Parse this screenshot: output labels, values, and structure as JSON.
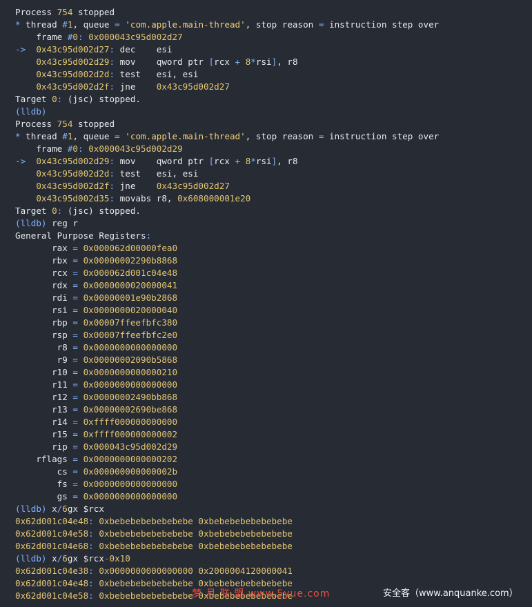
{
  "terminal": {
    "lines": [
      [
        [
          "w",
          "Process "
        ],
        [
          "y",
          "754"
        ],
        [
          "w",
          " stopped"
        ]
      ],
      [
        [
          "b",
          "* "
        ],
        [
          "w",
          "thread "
        ],
        [
          "b",
          "#"
        ],
        [
          "y",
          "1"
        ],
        [
          "w",
          ", queue "
        ],
        [
          "b",
          "="
        ],
        [
          "w",
          " "
        ],
        [
          "s",
          "'com.apple.main-thread'"
        ],
        [
          "w",
          ", stop reason "
        ],
        [
          "b",
          "="
        ],
        [
          "w",
          " instruction step over"
        ]
      ],
      [
        [
          "w",
          "    frame "
        ],
        [
          "b",
          "#"
        ],
        [
          "y",
          "0"
        ],
        [
          "b",
          ": "
        ],
        [
          "y",
          "0x000043c95d002d27"
        ]
      ],
      [
        [
          "b",
          "->  "
        ],
        [
          "y",
          "0x43c95d002d27"
        ],
        [
          "b",
          ": "
        ],
        [
          "w",
          "dec    esi"
        ]
      ],
      [
        [
          "w",
          "    "
        ],
        [
          "y",
          "0x43c95d002d29"
        ],
        [
          "b",
          ": "
        ],
        [
          "w",
          "mov    qword ptr "
        ],
        [
          "b",
          "["
        ],
        [
          "w",
          "rcx "
        ],
        [
          "b",
          "+"
        ],
        [
          "w",
          " "
        ],
        [
          "y",
          "8"
        ],
        [
          "b",
          "*"
        ],
        [
          "w",
          "rsi"
        ],
        [
          "b",
          "]"
        ],
        [
          "w",
          ", r8"
        ]
      ],
      [
        [
          "w",
          "    "
        ],
        [
          "y",
          "0x43c95d002d2d"
        ],
        [
          "b",
          ": "
        ],
        [
          "w",
          "test   esi, esi"
        ]
      ],
      [
        [
          "w",
          "    "
        ],
        [
          "y",
          "0x43c95d002d2f"
        ],
        [
          "b",
          ": "
        ],
        [
          "w",
          "jne    "
        ],
        [
          "y",
          "0x43c95d002d27"
        ]
      ],
      [
        [
          "w",
          "Target "
        ],
        [
          "y",
          "0"
        ],
        [
          "b",
          ": "
        ],
        [
          "w",
          "(jsc) stopped."
        ]
      ],
      [
        [
          "b",
          "(lldb)"
        ]
      ],
      [
        [
          "w",
          "Process "
        ],
        [
          "y",
          "754"
        ],
        [
          "w",
          " stopped"
        ]
      ],
      [
        [
          "b",
          "* "
        ],
        [
          "w",
          "thread "
        ],
        [
          "b",
          "#"
        ],
        [
          "y",
          "1"
        ],
        [
          "w",
          ", queue "
        ],
        [
          "b",
          "="
        ],
        [
          "w",
          " "
        ],
        [
          "s",
          "'com.apple.main-thread'"
        ],
        [
          "w",
          ", stop reason "
        ],
        [
          "b",
          "="
        ],
        [
          "w",
          " instruction step over"
        ]
      ],
      [
        [
          "w",
          "    frame "
        ],
        [
          "b",
          "#"
        ],
        [
          "y",
          "0"
        ],
        [
          "b",
          ": "
        ],
        [
          "y",
          "0x000043c95d002d29"
        ]
      ],
      [
        [
          "b",
          "->  "
        ],
        [
          "y",
          "0x43c95d002d29"
        ],
        [
          "b",
          ": "
        ],
        [
          "w",
          "mov    qword ptr "
        ],
        [
          "b",
          "["
        ],
        [
          "w",
          "rcx "
        ],
        [
          "b",
          "+"
        ],
        [
          "w",
          " "
        ],
        [
          "y",
          "8"
        ],
        [
          "b",
          "*"
        ],
        [
          "w",
          "rsi"
        ],
        [
          "b",
          "]"
        ],
        [
          "w",
          ", r8"
        ]
      ],
      [
        [
          "w",
          "    "
        ],
        [
          "y",
          "0x43c95d002d2d"
        ],
        [
          "b",
          ": "
        ],
        [
          "w",
          "test   esi, esi"
        ]
      ],
      [
        [
          "w",
          "    "
        ],
        [
          "y",
          "0x43c95d002d2f"
        ],
        [
          "b",
          ": "
        ],
        [
          "w",
          "jne    "
        ],
        [
          "y",
          "0x43c95d002d27"
        ]
      ],
      [
        [
          "w",
          "    "
        ],
        [
          "y",
          "0x43c95d002d35"
        ],
        [
          "b",
          ": "
        ],
        [
          "w",
          "movabs r8, "
        ],
        [
          "y",
          "0x608000001e20"
        ]
      ],
      [
        [
          "w",
          "Target "
        ],
        [
          "y",
          "0"
        ],
        [
          "b",
          ": "
        ],
        [
          "w",
          "(jsc) stopped."
        ]
      ],
      [
        [
          "b",
          "(lldb) "
        ],
        [
          "w",
          "reg r"
        ]
      ],
      [
        [
          "w",
          "General Purpose Registers"
        ],
        [
          "b",
          ":"
        ]
      ],
      [
        [
          "w",
          "       rax "
        ],
        [
          "b",
          "="
        ],
        [
          "w",
          " "
        ],
        [
          "y",
          "0x000062d00000fea0"
        ]
      ],
      [
        [
          "w",
          "       rbx "
        ],
        [
          "b",
          "="
        ],
        [
          "w",
          " "
        ],
        [
          "y",
          "0x00000002290b8868"
        ]
      ],
      [
        [
          "w",
          "       rcx "
        ],
        [
          "b",
          "="
        ],
        [
          "w",
          " "
        ],
        [
          "y",
          "0x000062d001c04e48"
        ]
      ],
      [
        [
          "w",
          "       rdx "
        ],
        [
          "b",
          "="
        ],
        [
          "w",
          " "
        ],
        [
          "y",
          "0x0000000020000041"
        ]
      ],
      [
        [
          "w",
          "       rdi "
        ],
        [
          "b",
          "="
        ],
        [
          "w",
          " "
        ],
        [
          "y",
          "0x00000001e90b2868"
        ]
      ],
      [
        [
          "w",
          "       rsi "
        ],
        [
          "b",
          "="
        ],
        [
          "w",
          " "
        ],
        [
          "y",
          "0x0000000020000040"
        ]
      ],
      [
        [
          "w",
          "       rbp "
        ],
        [
          "b",
          "="
        ],
        [
          "w",
          " "
        ],
        [
          "y",
          "0x00007ffeefbfc380"
        ]
      ],
      [
        [
          "w",
          "       rsp "
        ],
        [
          "b",
          "="
        ],
        [
          "w",
          " "
        ],
        [
          "y",
          "0x00007ffeefbfc2e0"
        ]
      ],
      [
        [
          "w",
          "        r8 "
        ],
        [
          "b",
          "="
        ],
        [
          "w",
          " "
        ],
        [
          "y",
          "0x0000000000000000"
        ]
      ],
      [
        [
          "w",
          "        r9 "
        ],
        [
          "b",
          "="
        ],
        [
          "w",
          " "
        ],
        [
          "y",
          "0x00000002090b5868"
        ]
      ],
      [
        [
          "w",
          "       r10 "
        ],
        [
          "b",
          "="
        ],
        [
          "w",
          " "
        ],
        [
          "y",
          "0x0000000000000210"
        ]
      ],
      [
        [
          "w",
          "       r11 "
        ],
        [
          "b",
          "="
        ],
        [
          "w",
          " "
        ],
        [
          "y",
          "0x0000000000000000"
        ]
      ],
      [
        [
          "w",
          "       r12 "
        ],
        [
          "b",
          "="
        ],
        [
          "w",
          " "
        ],
        [
          "y",
          "0x00000002490bb868"
        ]
      ],
      [
        [
          "w",
          "       r13 "
        ],
        [
          "b",
          "="
        ],
        [
          "w",
          " "
        ],
        [
          "y",
          "0x00000002690be868"
        ]
      ],
      [
        [
          "w",
          "       r14 "
        ],
        [
          "b",
          "="
        ],
        [
          "w",
          " "
        ],
        [
          "y",
          "0xffff000000000000"
        ]
      ],
      [
        [
          "w",
          "       r15 "
        ],
        [
          "b",
          "="
        ],
        [
          "w",
          " "
        ],
        [
          "y",
          "0xffff000000000002"
        ]
      ],
      [
        [
          "w",
          "       rip "
        ],
        [
          "b",
          "="
        ],
        [
          "w",
          " "
        ],
        [
          "y",
          "0x000043c95d002d29"
        ]
      ],
      [
        [
          "w",
          "    rflags "
        ],
        [
          "b",
          "="
        ],
        [
          "w",
          " "
        ],
        [
          "y",
          "0x0000000000000202"
        ]
      ],
      [
        [
          "w",
          "        cs "
        ],
        [
          "b",
          "="
        ],
        [
          "w",
          " "
        ],
        [
          "y",
          "0x000000000000002b"
        ]
      ],
      [
        [
          "w",
          "        fs "
        ],
        [
          "b",
          "="
        ],
        [
          "w",
          " "
        ],
        [
          "y",
          "0x0000000000000000"
        ]
      ],
      [
        [
          "w",
          "        gs "
        ],
        [
          "b",
          "="
        ],
        [
          "w",
          " "
        ],
        [
          "y",
          "0x0000000000000000"
        ]
      ],
      [
        [
          "b",
          "(lldb) "
        ],
        [
          "w",
          "x"
        ],
        [
          "b",
          "/"
        ],
        [
          "y",
          "6"
        ],
        [
          "w",
          "gx $rcx"
        ]
      ],
      [
        [
          "y",
          "0x62d001c04e48"
        ],
        [
          "b",
          ": "
        ],
        [
          "y",
          "0xbebebebebebebebe 0xbebebebebebebebe"
        ]
      ],
      [
        [
          "y",
          "0x62d001c04e58"
        ],
        [
          "b",
          ": "
        ],
        [
          "y",
          "0xbebebebebebebebe 0xbebebebebebebebe"
        ]
      ],
      [
        [
          "y",
          "0x62d001c04e68"
        ],
        [
          "b",
          ": "
        ],
        [
          "y",
          "0xbebebebebebebebe 0xbebebebebebebebe"
        ]
      ],
      [
        [
          "b",
          "(lldb) "
        ],
        [
          "w",
          "x"
        ],
        [
          "b",
          "/"
        ],
        [
          "y",
          "6"
        ],
        [
          "w",
          "gx $rcx"
        ],
        [
          "b",
          "-"
        ],
        [
          "y",
          "0x10"
        ]
      ],
      [
        [
          "y",
          "0x62d001c04e38"
        ],
        [
          "b",
          ": "
        ],
        [
          "y",
          "0x0000000000000000 0x2000004120000041"
        ]
      ],
      [
        [
          "y",
          "0x62d001c04e48"
        ],
        [
          "b",
          ": "
        ],
        [
          "y",
          "0xbebebebebebebebe 0xbebebebebebebebe"
        ]
      ],
      [
        [
          "y",
          "0x62d001c04e58"
        ],
        [
          "b",
          ": "
        ],
        [
          "y",
          "0xbebebebebebebebe 0xbebebebebebebebe"
        ]
      ]
    ]
  },
  "watermarks": {
    "left": "梦 月 联 盟  www.5yue.com",
    "right": "安全客（www.anquanke.com）"
  },
  "colors": {
    "background": "#272b34",
    "text": "#e6e9ee",
    "number": "#e3c672",
    "punctuation": "#7fb2ff",
    "string": "#f2cf7a",
    "watermark_red": "#f04a3c"
  }
}
